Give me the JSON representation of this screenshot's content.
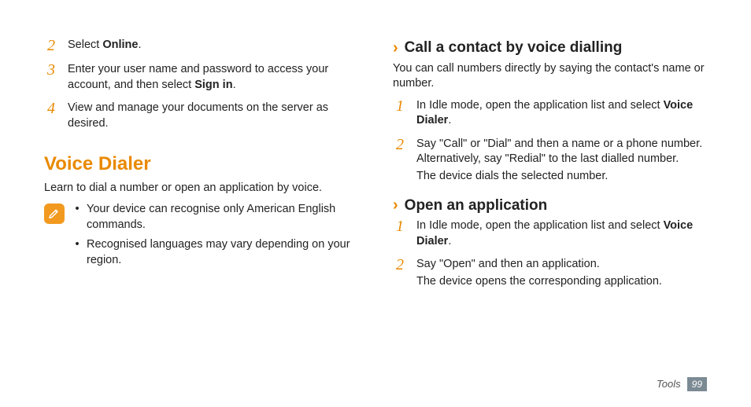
{
  "left": {
    "steps": [
      {
        "num": "2",
        "parts": [
          "Select ",
          "Online",
          "."
        ]
      },
      {
        "num": "3",
        "parts": [
          "Enter your user name and password to access your account, and then select ",
          "Sign in",
          "."
        ]
      },
      {
        "num": "4",
        "text": "View and manage your documents on the server as desired."
      }
    ],
    "h1": "Voice Dialer",
    "lead": "Learn to dial a number or open an application by voice.",
    "notes": [
      "Your device can recognise only American English commands.",
      "Recognised languages may vary depending on your region."
    ]
  },
  "right": {
    "sec1": {
      "title": "Call a contact by voice dialling",
      "intro": "You can call numbers directly by saying the contact's name or number.",
      "steps": [
        {
          "num": "1",
          "parts": [
            "In Idle mode, open the application list and select ",
            "Voice Dialer",
            "."
          ]
        },
        {
          "num": "2",
          "text": "Say \"Call\" or \"Dial\" and then a name or a phone number. Alternatively, say \"Redial\" to the last dialled number.",
          "sub": "The device dials the selected number."
        }
      ]
    },
    "sec2": {
      "title": "Open an application",
      "steps": [
        {
          "num": "1",
          "parts": [
            "In Idle mode, open the application list and select ",
            "Voice Dialer",
            "."
          ]
        },
        {
          "num": "2",
          "text": "Say \"Open\" and then an application.",
          "sub": "The device opens the corresponding application."
        }
      ]
    }
  },
  "footer": {
    "section": "Tools",
    "page": "99"
  }
}
